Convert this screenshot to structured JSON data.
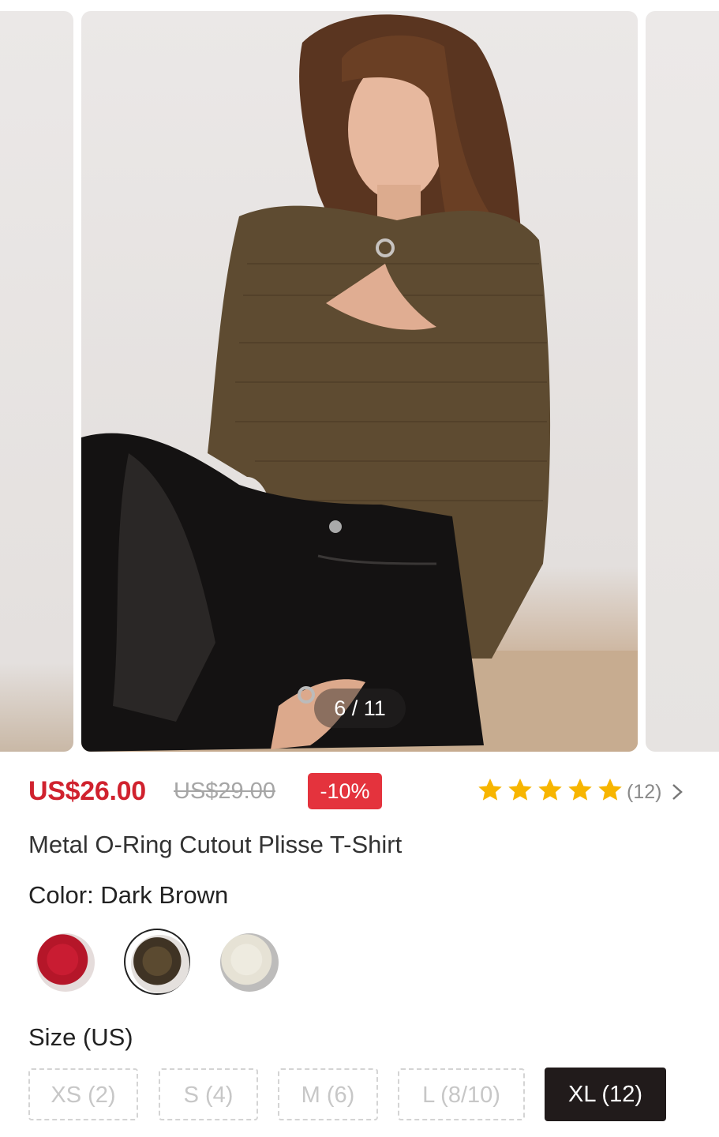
{
  "gallery": {
    "counter": "6 / 11"
  },
  "price": {
    "current": "US$26.00",
    "original": "US$29.00",
    "discount": "-10%"
  },
  "rating": {
    "stars": 5,
    "count": "(12)",
    "star_color": "#f7b500"
  },
  "product": {
    "title": "Metal O-Ring Cutout Plisse T-Shirt"
  },
  "color": {
    "label": "Color: Dark Brown",
    "selected": "Dark Brown",
    "swatches": [
      {
        "name": "red"
      },
      {
        "name": "dark-brown"
      },
      {
        "name": "cream"
      }
    ]
  },
  "size": {
    "label": "Size (US)",
    "options": [
      "XS (2)",
      "S (4)",
      "M (6)",
      "L (8/10)",
      "XL (12)"
    ],
    "selected": "XL (12)"
  },
  "theme": {
    "accent_red": "#d0222e",
    "badge_red": "#e4333d",
    "selected_bg": "#211b1b"
  }
}
